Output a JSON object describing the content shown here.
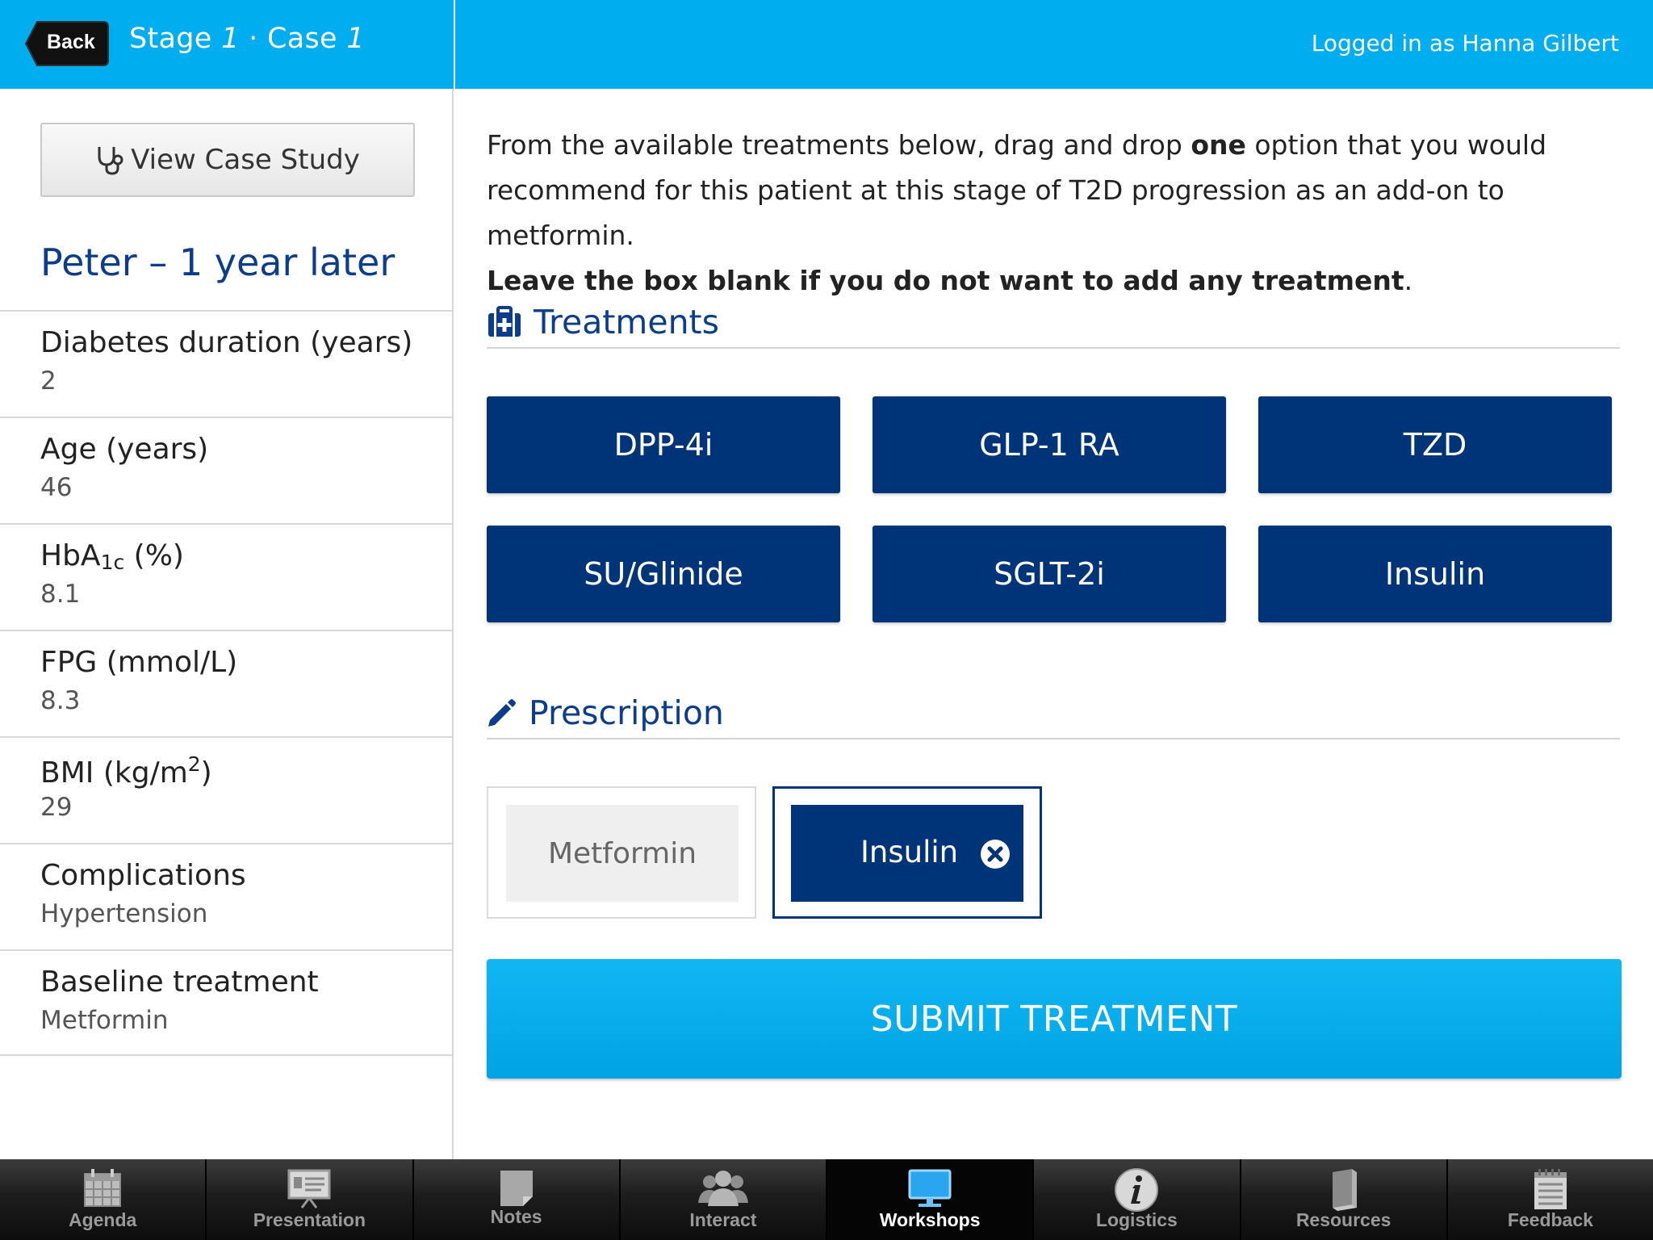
{
  "header": {
    "back_label": "Back",
    "stage_word": "Stage",
    "stage_number": "1",
    "separator": "·",
    "case_word": "Case",
    "case_number": "1",
    "login_text": "Logged in as Hanna Gilbert"
  },
  "sidebar": {
    "view_case_label": "View Case Study",
    "patient_title": "Peter – 1 year later",
    "stats": [
      {
        "label": "Diabetes duration (years)",
        "value": "2"
      },
      {
        "label": "Age (years)",
        "value": "46"
      },
      {
        "label_main": "HbA",
        "label_sub": "1c",
        "label_tail": " (%)",
        "value": "8.1"
      },
      {
        "label": "FPG (mmol/L)",
        "value": "8.3"
      },
      {
        "label_main": "BMI (kg/m",
        "label_sup": "2",
        "label_tail": ")",
        "value": "29"
      },
      {
        "label": "Complications",
        "value": "Hypertension"
      },
      {
        "label": "Baseline treatment",
        "value": "Metformin"
      }
    ]
  },
  "main": {
    "instructions": {
      "part1": "From the available treatments below, drag and drop ",
      "bold1": "one",
      "part2": " option that you would recommend for this patient at this stage of T2D progression as an add-on to metformin.",
      "bold2": "Leave the box blank if you do not want to add any treatment",
      "part3": "."
    },
    "treatments_title": "Treatments",
    "treatments": [
      "DPP-4i",
      "GLP-1 RA",
      "TZD",
      "SU/Glinide",
      "SGLT-2i",
      "Insulin"
    ],
    "prescription_title": "Prescription",
    "prescription": {
      "fixed": "Metformin",
      "added": "Insulin"
    },
    "submit_label": "SUBMIT TREATMENT"
  },
  "tabbar": {
    "tabs": [
      "Agenda",
      "Presentation",
      "Notes",
      "Interact",
      "Workshops",
      "Logistics",
      "Resources",
      "Feedback"
    ],
    "active": "Workshops"
  },
  "colors": {
    "header": "#00aeef",
    "navy": "#003478",
    "title_blue": "#0c3d8c",
    "submit": "#00a3e4"
  }
}
